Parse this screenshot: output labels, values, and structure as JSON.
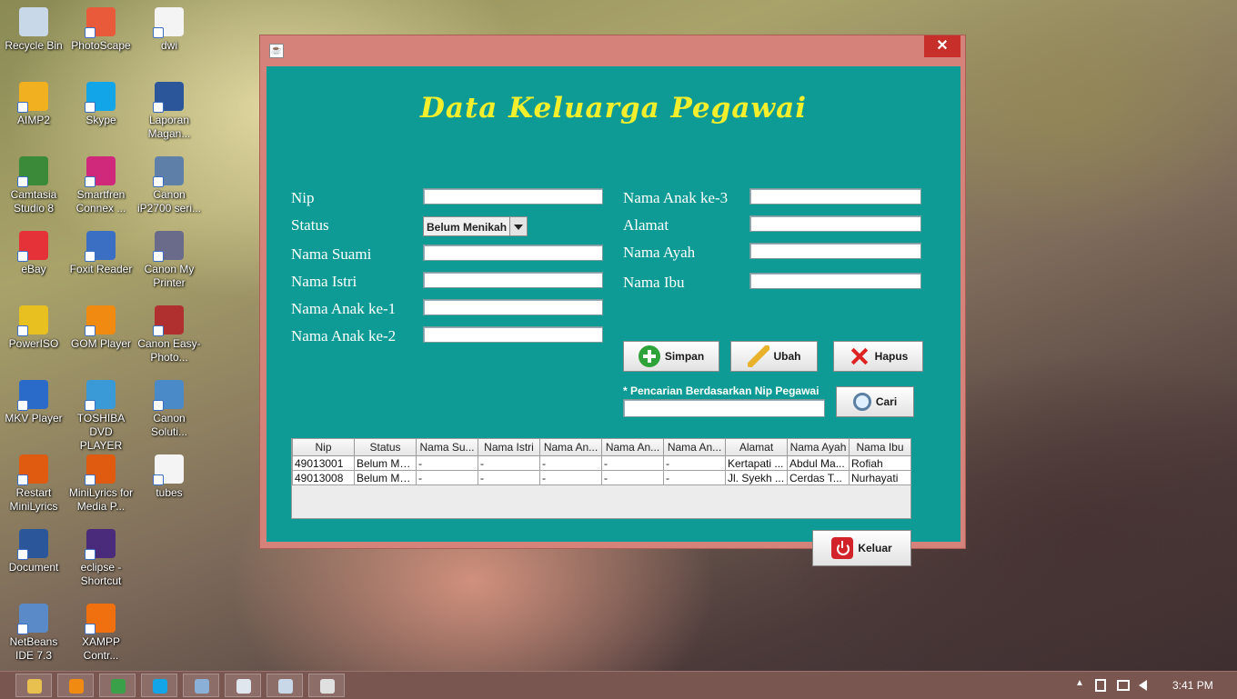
{
  "desktop": {
    "icons": [
      {
        "label": "Recycle Bin",
        "icon": "recycle-bin-icon",
        "color": "#c8d8e8"
      },
      {
        "label": "PhotoScape",
        "icon": "photoscape-icon",
        "color": "#e85a3a"
      },
      {
        "label": "dwi",
        "icon": "document-icon",
        "color": "#f4f4f4"
      },
      {
        "label": "AIMP2",
        "icon": "aimp-icon",
        "color": "#f0b020"
      },
      {
        "label": "Skype",
        "icon": "skype-icon",
        "color": "#12a6e8"
      },
      {
        "label": "Laporan Magan...",
        "icon": "word-doc-icon",
        "color": "#2b579a"
      },
      {
        "label": "Camtasia Studio 8",
        "icon": "camtasia-icon",
        "color": "#3a8a3a"
      },
      {
        "label": "Smartfren Connex ...",
        "icon": "smartfren-icon",
        "color": "#d0287a"
      },
      {
        "label": "Canon iP2700 seri...",
        "icon": "canon-printer-icon",
        "color": "#5d7fa8"
      },
      {
        "label": "eBay",
        "icon": "ebay-icon",
        "color": "#e53238"
      },
      {
        "label": "Foxit Reader",
        "icon": "foxit-icon",
        "color": "#3a6fc4"
      },
      {
        "label": "Canon My Printer",
        "icon": "canon-my-printer-icon",
        "color": "#6a6a8a"
      },
      {
        "label": "PowerISO",
        "icon": "poweriso-icon",
        "color": "#e8c020"
      },
      {
        "label": "GOM Player",
        "icon": "gom-player-icon",
        "color": "#f08a10"
      },
      {
        "label": "Canon Easy-Photo...",
        "icon": "canon-easy-photo-icon",
        "color": "#b03030"
      },
      {
        "label": "MKV Player",
        "icon": "mkv-player-icon",
        "color": "#2a6ac8"
      },
      {
        "label": "TOSHIBA DVD PLAYER",
        "icon": "toshiba-dvd-icon",
        "color": "#3a9ad8"
      },
      {
        "label": "Canon Soluti...",
        "icon": "canon-solution-icon",
        "color": "#4a8ac8"
      },
      {
        "label": "Restart MiniLyrics",
        "icon": "minilyrics-icon",
        "color": "#e05a10"
      },
      {
        "label": "MiniLyrics for Media P...",
        "icon": "minilyrics-media-icon",
        "color": "#e05a10"
      },
      {
        "label": "tubes",
        "icon": "document-icon",
        "color": "#f4f4f4"
      },
      {
        "label": "Document",
        "icon": "word-doc-icon",
        "color": "#2b579a"
      },
      {
        "label": "eclipse - Shortcut",
        "icon": "eclipse-icon",
        "color": "#4a2a7a"
      },
      {
        "label": "NetBeans IDE 7.3",
        "icon": "netbeans-icon",
        "color": "#5a8ac8"
      },
      {
        "label": "XAMPP Contr...",
        "icon": "xampp-icon",
        "color": "#f07010"
      }
    ]
  },
  "window": {
    "close_label": "✕",
    "java_icon": "☕",
    "title": "Data Keluarga Pegawai",
    "labels": {
      "nip": "Nip",
      "status": "Status",
      "nama_suami": "Nama Suami",
      "nama_istri": "Nama Istri",
      "nama_anak1": "Nama Anak ke-1",
      "nama_anak2": "Nama Anak ke-2",
      "nama_anak3": "Nama Anak ke-3",
      "alamat": "Alamat",
      "nama_ayah": "Nama Ayah",
      "nama_ibu": "Nama Ibu"
    },
    "status_value": "Belum Menikah",
    "fields": {
      "nip": "",
      "nama_suami": "",
      "nama_istri": "",
      "nama_anak1": "",
      "nama_anak2": "",
      "nama_anak3": "",
      "alamat": "",
      "nama_ayah": "",
      "nama_ibu": "",
      "search": ""
    },
    "buttons": {
      "simpan": "Simpan",
      "ubah": "Ubah",
      "hapus": "Hapus",
      "cari": "Cari",
      "keluar": "Keluar"
    },
    "search_hint": "* Pencarian Berdasarkan Nip Pegawai",
    "table": {
      "columns": [
        "Nip",
        "Status",
        "Nama Su...",
        "Nama Istri",
        "Nama An...",
        "Nama An...",
        "Nama An...",
        "Alamat",
        "Nama Ayah",
        "Nama Ibu"
      ],
      "rows": [
        [
          "49013001",
          "Belum Me...",
          "-",
          "-",
          "-",
          "-",
          "-",
          "Kertapati ...",
          "Abdul Ma...",
          "Rofiah"
        ],
        [
          "49013008",
          "Belum Me...",
          "-",
          "-",
          "-",
          "-",
          "-",
          "Jl. Syekh ...",
          "Cerdas T...",
          "Nurhayati"
        ]
      ]
    }
  },
  "taskbar": {
    "apps": [
      {
        "icon": "file-explorer-icon",
        "color": "#e8c050"
      },
      {
        "icon": "media-player-icon",
        "color": "#f08a10"
      },
      {
        "icon": "chrome-icon",
        "color": "#3aa04a"
      },
      {
        "icon": "skype-icon",
        "color": "#12a6e8"
      },
      {
        "icon": "netbeans-icon",
        "color": "#8ab0d8"
      },
      {
        "icon": "notepad-icon",
        "color": "#dfe6ee"
      },
      {
        "icon": "paint-icon",
        "color": "#c8d8e8"
      },
      {
        "icon": "java-app-icon",
        "color": "#e0e0e0"
      }
    ],
    "clock": "3:41 PM",
    "tray_up": "▲"
  }
}
